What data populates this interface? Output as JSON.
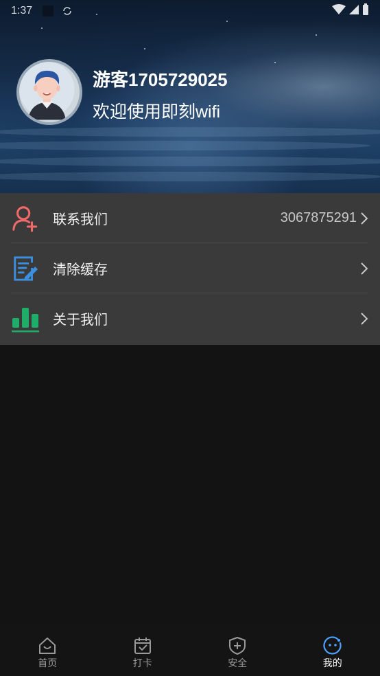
{
  "status_bar": {
    "time": "1:37"
  },
  "profile": {
    "username": "游客1705729025",
    "welcome": "欢迎使用即刻wifi"
  },
  "menu": {
    "items": [
      {
        "label": "联系我们",
        "value": "3067875291",
        "icon": "add-contact-icon",
        "color": "#f06a6a"
      },
      {
        "label": "清除缓存",
        "value": "",
        "icon": "edit-note-icon",
        "color": "#3b8fe0"
      },
      {
        "label": "关于我们",
        "value": "",
        "icon": "bar-chart-icon",
        "color": "#1fae6a"
      }
    ]
  },
  "bottom_nav": {
    "items": [
      {
        "label": "首页",
        "icon": "home-icon",
        "active": false
      },
      {
        "label": "打卡",
        "icon": "calendar-check-icon",
        "active": false
      },
      {
        "label": "安全",
        "icon": "shield-plus-icon",
        "active": false
      },
      {
        "label": "我的",
        "icon": "face-icon",
        "active": true
      }
    ]
  },
  "colors": {
    "background": "#131314",
    "menu_bg": "#3a3a3a",
    "nav_bg": "#141415",
    "active_icon": "#4ea1ff"
  }
}
